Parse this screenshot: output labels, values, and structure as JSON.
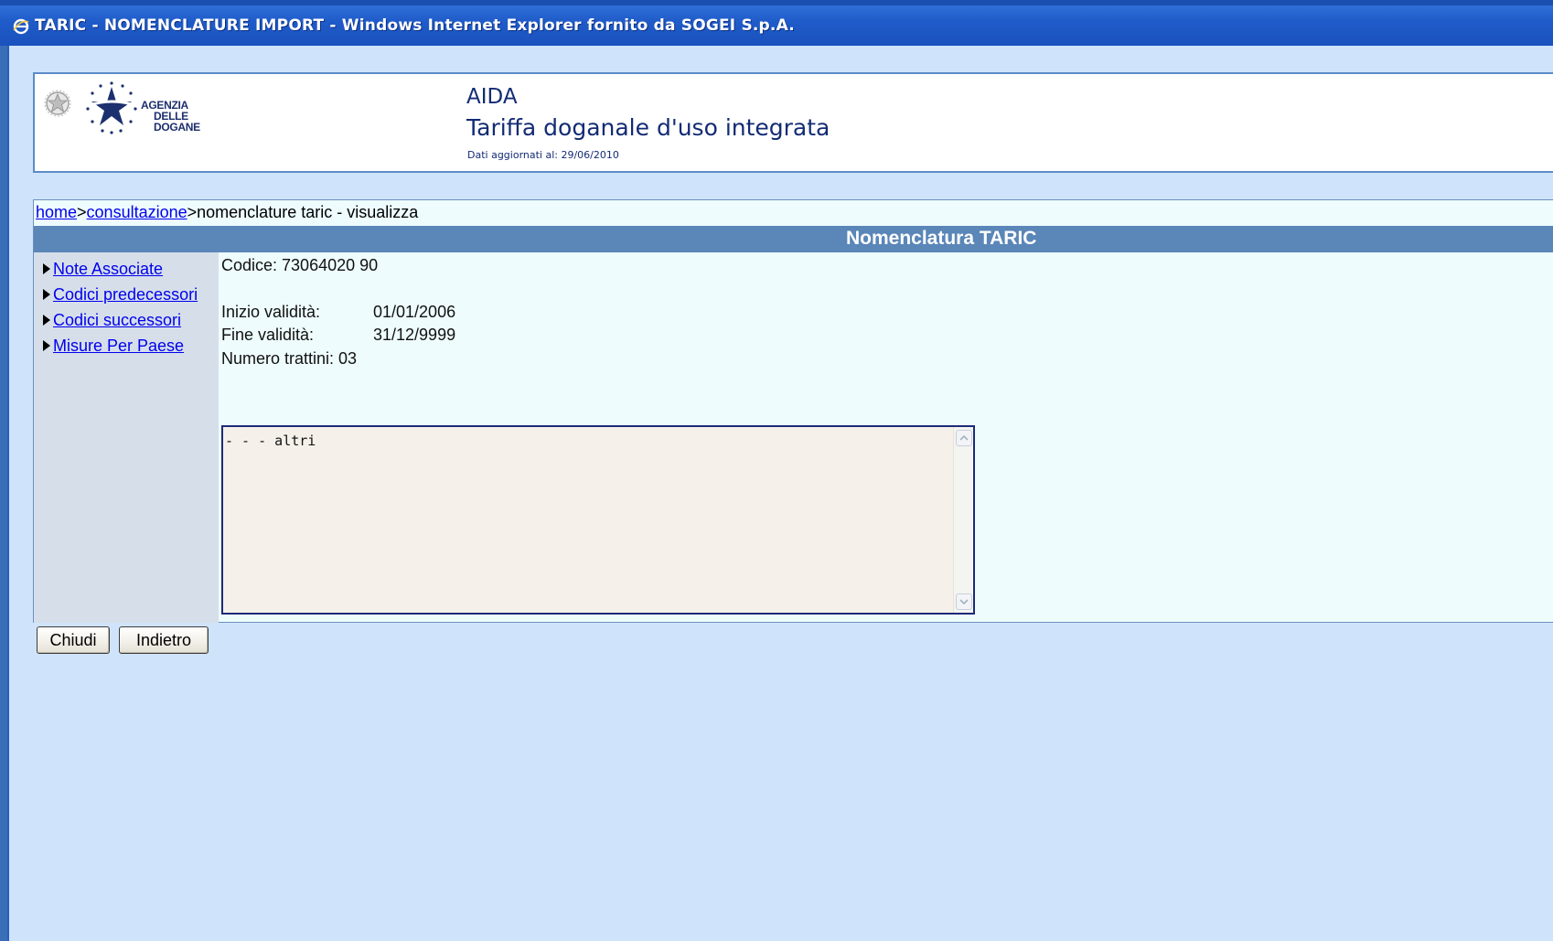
{
  "window": {
    "title": "TARIC - NOMENCLATURE IMPORT - Windows Internet Explorer fornito da SOGEI S.p.A."
  },
  "header": {
    "logo_lines": [
      "AGENZIA",
      "DELLE",
      "DOGANE"
    ],
    "app_name": "AIDA",
    "app_subtitle": "Tariffa doganale d'uso integrata",
    "updated_label": "Dati aggiornati al: 29/06/2010"
  },
  "breadcrumb": {
    "home": "home",
    "sep1": ">",
    "consultazione": "consultazione",
    "sep2": ">",
    "current": "nomenclature taric - visualizza"
  },
  "section_title": "Nomenclatura TARIC",
  "sidebar": {
    "items": [
      {
        "label": "Note Associate"
      },
      {
        "label": "Codici predecessori"
      },
      {
        "label": "Codici successori"
      },
      {
        "label": "Misure Per Paese"
      }
    ]
  },
  "details": {
    "codice": "Codice: 73064020 90",
    "inizio_label": "Inizio validità:",
    "inizio_value": "01/01/2006",
    "fine_label": "Fine validità:",
    "fine_value": "31/12/9999",
    "trattini": "Numero trattini: 03"
  },
  "description": "- - - altri",
  "buttons": {
    "close": "Chiudi",
    "back": "Indietro"
  },
  "colors": {
    "titlebar": "#1f5bc9",
    "window_bg": "#cfe4fb",
    "section_header": "#5a86b8",
    "content_bg": "#eefcfd",
    "sidebar_bg": "#d6dfe9",
    "link": "#0000ee",
    "brand_text": "#132b75"
  }
}
